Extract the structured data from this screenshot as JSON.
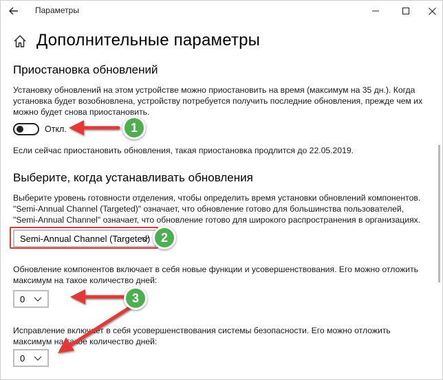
{
  "window": {
    "title": "Параметры"
  },
  "page": {
    "title": "Дополнительные параметры"
  },
  "pause_section": {
    "heading": "Приостановка обновлений",
    "description": "Установку обновлений на этом устройстве можно приостановить на время (максимум на 35 дн.). Когда установка будет возобновлена, устройству потребуется получить последние обновления, прежде чем их можно будет снова приостановить.",
    "toggle_state": "Откл.",
    "note": "Если сейчас приостановить обновления, такая приостановка продлится до 22.05.2019."
  },
  "channel_section": {
    "heading": "Выберите, когда устанавливать обновления",
    "description": "Выберите уровень готовности отделения, чтобы определить время установки обновлений компонентов. \"Semi-Annual Channel (Targeted)\" означает, что обновление готово для большинства пользователей, \"Semi-Annual Channel\" означает, что обновление готово для широкого распространения в организациях.",
    "channel_value": "Semi-Annual Channel (Targeted)",
    "feature_description": "Обновление компонентов включает в себя новые функции и усовершенствования. Его можно отложить максимум на такое количество дней:",
    "feature_days": "0",
    "quality_description": "Исправление включает в себя усовершенствования системы безопасности. Его можно отложить максимум на такое количество дней:",
    "quality_days": "0"
  },
  "annotations": {
    "badge1": "1",
    "badge2": "2",
    "badge3": "3",
    "accent_color": "#4caf50",
    "arrow_color": "#e53935"
  }
}
